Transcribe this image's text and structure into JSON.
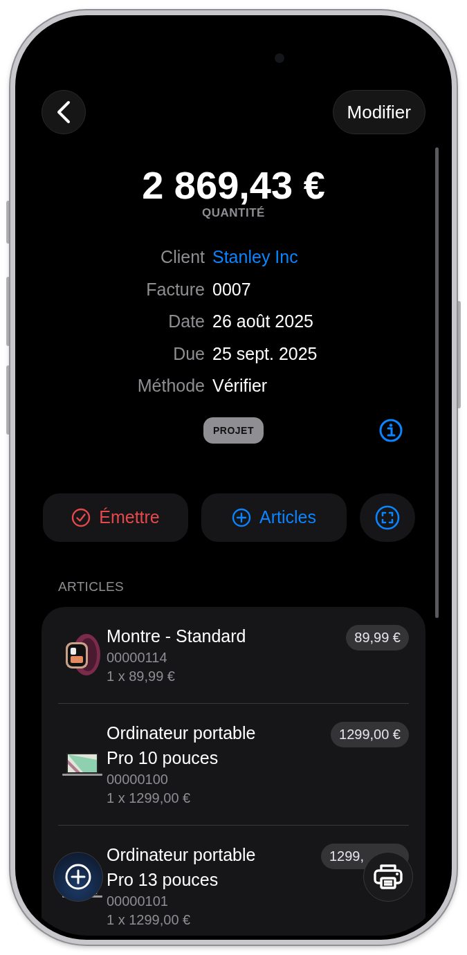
{
  "edit_button": "Modifier",
  "total": {
    "amount": "2 869,43 €",
    "label": "QUANTITÉ"
  },
  "details": [
    {
      "label": "Client",
      "value": "Stanley Inc",
      "link": true
    },
    {
      "label": "Facture",
      "value": "0007",
      "link": false
    },
    {
      "label": "Date",
      "value": "26 août 2025",
      "link": false
    },
    {
      "label": "Due",
      "value": "25 sept. 2025",
      "link": false
    },
    {
      "label": "Méthode",
      "value": "Vérifier",
      "link": false
    }
  ],
  "status_badge": "PROJET",
  "actions": [
    {
      "kind": "issue",
      "label": "Émettre"
    },
    {
      "kind": "add",
      "label": "Articles"
    },
    {
      "kind": "scan"
    }
  ],
  "section_title": "ARTICLES",
  "items": [
    {
      "kind": "watch",
      "name": "Montre - Standard",
      "code": "00000114",
      "quantity": "1 x 89,99 €",
      "price": "89,99 €"
    },
    {
      "kind": "laptop",
      "name": "Ordinateur portable Pro 10 pouces",
      "code": "00000100",
      "quantity": "1 x 1299,00 €",
      "price": "1299,00 €"
    },
    {
      "kind": "laptop",
      "name": "Ordinateur portable Pro 13 pouces",
      "code": "00000101",
      "quantity": "1 x 1299,00 €",
      "price": "1299,"
    }
  ]
}
